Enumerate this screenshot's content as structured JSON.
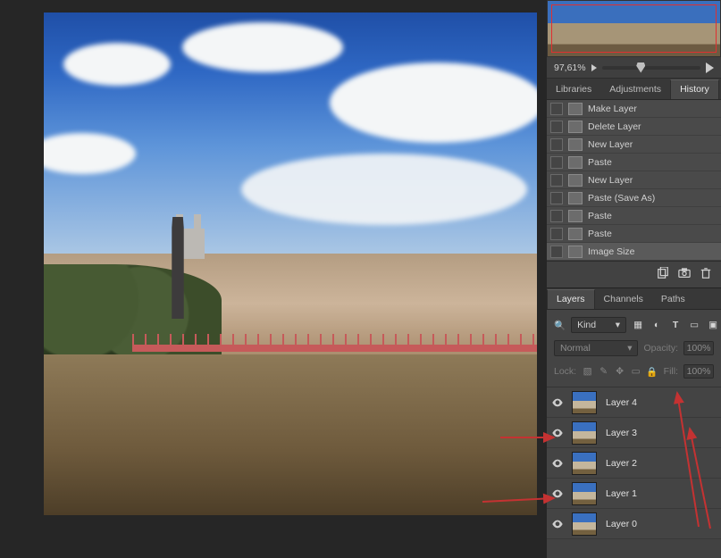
{
  "navigator": {
    "zoom_pct": "97,61%"
  },
  "history_panel": {
    "tabs": [
      "Libraries",
      "Adjustments",
      "History"
    ],
    "active_tab": 2,
    "items": [
      "Make Layer",
      "Delete Layer",
      "New Layer",
      "Paste",
      "New Layer",
      "Paste (Save As)",
      "Paste",
      "Paste",
      "Image Size"
    ],
    "active_index": 8
  },
  "layers_panel": {
    "tabs": [
      "Layers",
      "Channels",
      "Paths"
    ],
    "active_tab": 0,
    "filter_label": "Kind",
    "blend_mode": "Normal",
    "opacity_label": "Opacity:",
    "opacity_value": "100%",
    "lock_label": "Lock:",
    "fill_label": "Fill:",
    "fill_value": "100%",
    "layers": [
      {
        "name": "Layer 4"
      },
      {
        "name": "Layer 3"
      },
      {
        "name": "Layer 2"
      },
      {
        "name": "Layer 1"
      },
      {
        "name": "Layer 0"
      }
    ]
  }
}
